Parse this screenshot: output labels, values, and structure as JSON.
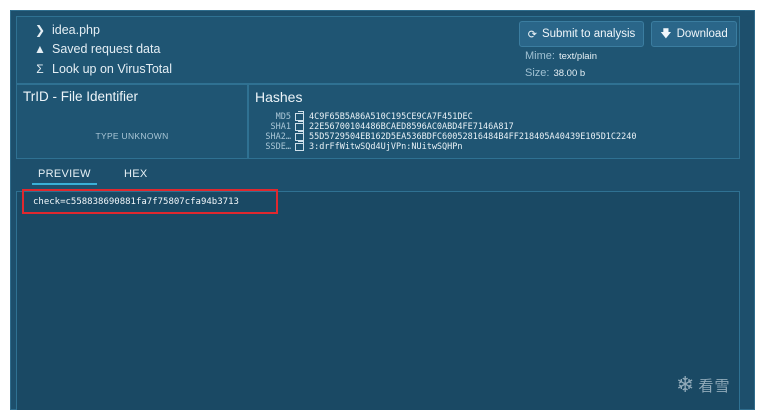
{
  "file": {
    "name": "idea.php",
    "saved": "Saved request data",
    "virustotal": "Look up on VirusTotal"
  },
  "actions": {
    "submit": "Submit to analysis",
    "download": "Download"
  },
  "meta": {
    "mime_label": "Mime:",
    "mime_value": "text/plain",
    "size_label": "Size:",
    "size_value": "38.00 b"
  },
  "trid": {
    "title": "TrID - File Identifier",
    "status": "TYPE UNKNOWN"
  },
  "hashes": {
    "title": "Hashes",
    "rows": [
      {
        "key": "MD5",
        "value": "4C9F65B5A86A510C195CE9CA7F451DEC"
      },
      {
        "key": "SHA1",
        "value": "22E56700104486BCAED8596AC0ABD4FE7146A817"
      },
      {
        "key": "SHA2…",
        "value": "55D5729504EB162D5EA536BDFC60052816484B4FF218405A40439E105D1C2240"
      },
      {
        "key": "SSDE…",
        "value": "3:drFfWitwSQd4UjVPn:NUitwSQHPn"
      }
    ]
  },
  "tabs": {
    "preview": "PREVIEW",
    "hex": "HEX"
  },
  "preview": {
    "content": "check=c558838690881fa7f75807cfa94b3713"
  },
  "watermark": {
    "text": "看雪"
  },
  "icons": {
    "chevron": "chevron-right-icon",
    "warning": "warning-icon",
    "sigma": "sigma-icon",
    "refresh": "refresh-icon",
    "download": "download-arrow-icon",
    "copy": "copy-icon",
    "snowflake": "snowflake-icon"
  },
  "colors": {
    "background": "#1d4f6c",
    "panel": "#1f5573",
    "accent": "#3ab0d8",
    "highlight": "#e0282e"
  }
}
